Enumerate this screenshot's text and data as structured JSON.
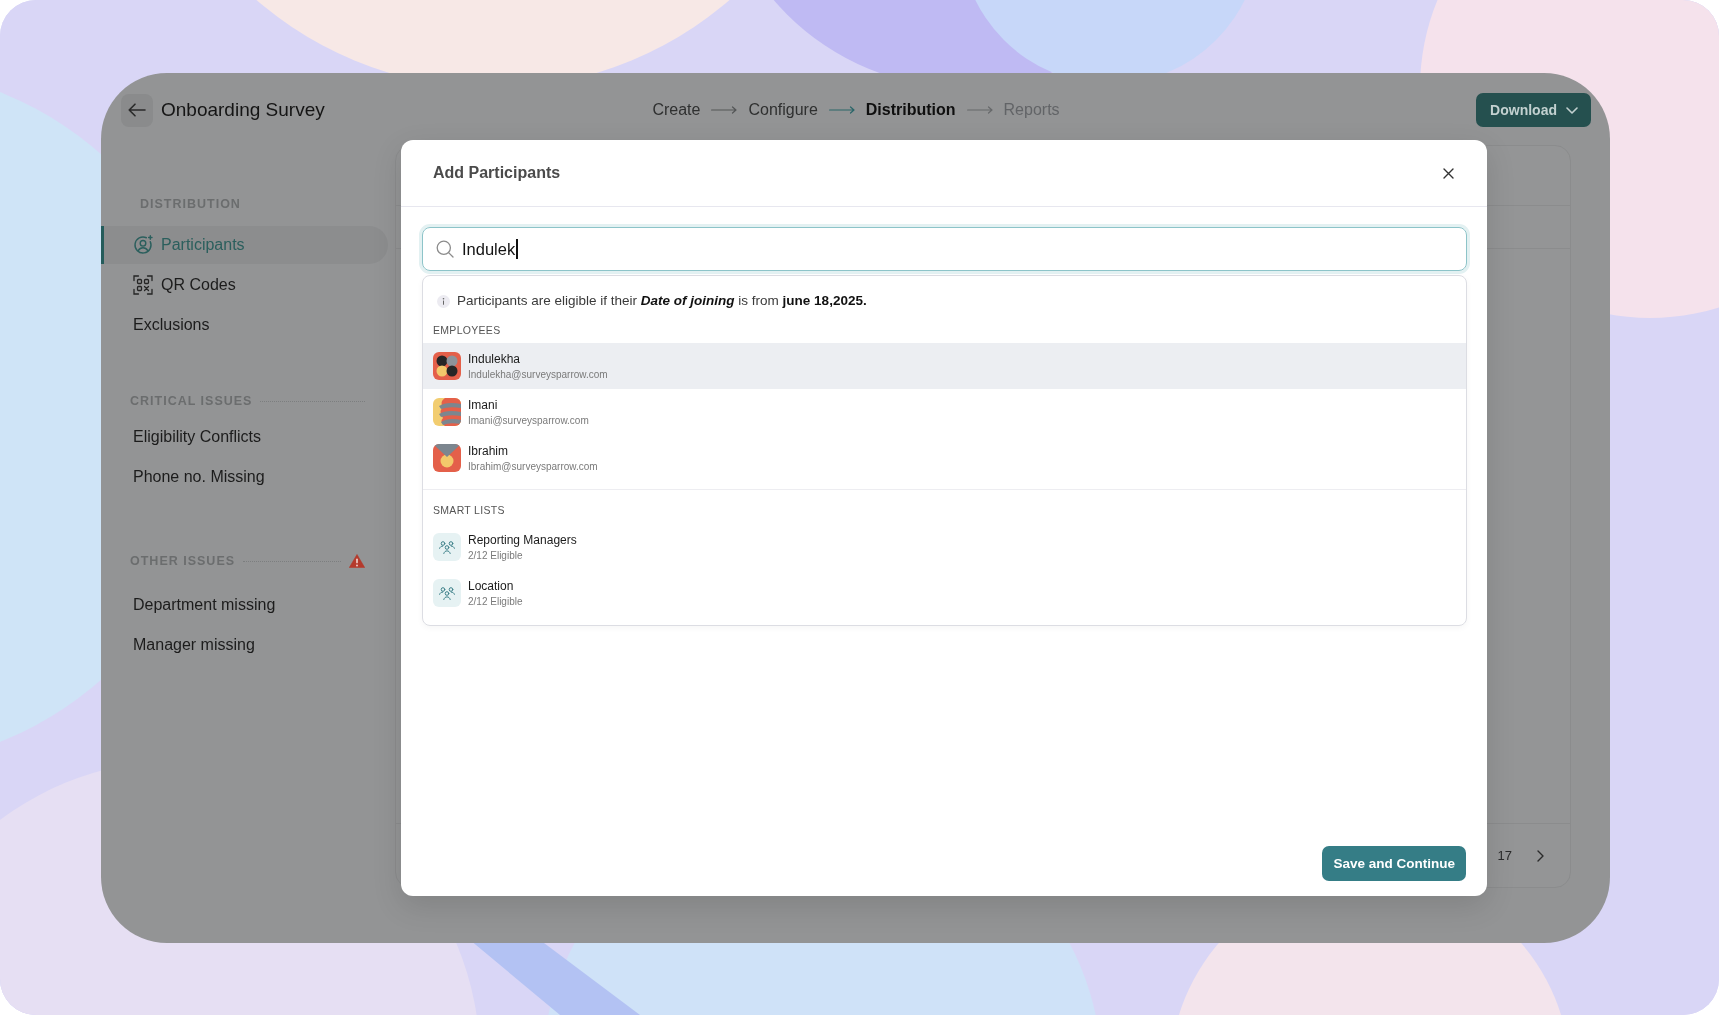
{
  "header": {
    "title": "Onboarding Survey",
    "steps": [
      {
        "label": "Create",
        "completed": true,
        "selected": false
      },
      {
        "label": "Configure",
        "completed": true,
        "selected": false
      },
      {
        "label": "Distribution",
        "completed": false,
        "selected": true
      },
      {
        "label": "Reports",
        "completed": false,
        "selected": false
      }
    ],
    "download_button": "Download"
  },
  "sidebar": {
    "sections": [
      {
        "kind": "nav",
        "heading": "DISTRIBUTION",
        "alert": false,
        "items": [
          {
            "label": "Participants",
            "selected": true
          },
          {
            "label": "QR Codes",
            "selected": false
          },
          {
            "label": "Exclusions",
            "selected": false
          }
        ]
      },
      {
        "kind": "issues",
        "heading": "CRITICAL ISSUES",
        "alert": false,
        "items": [
          {
            "label": "Eligibility Conflicts",
            "selected": false
          },
          {
            "label": "Phone no. Missing",
            "selected": false
          }
        ]
      },
      {
        "kind": "issues",
        "heading": "OTHER ISSUES",
        "alert": true,
        "items": [
          {
            "label": "Department missing",
            "selected": false
          },
          {
            "label": "Manager missing",
            "selected": false
          }
        ]
      }
    ]
  },
  "content": {
    "pagination": {
      "page": "17"
    }
  },
  "dialog": {
    "title": "Add Participants",
    "search": {
      "value": "Indulek"
    },
    "results": {
      "info": "Participants are eligible if their *Date of joining* is from **june 18,2025.**",
      "employees": {
        "heading": "EMPLOYEES",
        "items": [
          {
            "name": "Indulekha",
            "email": "Indulekha@surveysparrow.com",
            "selected": true
          },
          {
            "name": "Imani",
            "email": "Imani@surveysparrow.com",
            "selected": false
          },
          {
            "name": "Ibrahim",
            "email": "Ibrahim@surveysparrow.com",
            "selected": false
          }
        ]
      },
      "smart_lists": {
        "heading": "SMART LISTS",
        "items": [
          {
            "name": "Reporting Managers",
            "detail": "2/12 Eligible",
            "selected": false
          },
          {
            "name": "Location",
            "detail": "2/12 Eligible",
            "selected": false
          }
        ]
      }
    },
    "save_button": "Save and Continue"
  }
}
